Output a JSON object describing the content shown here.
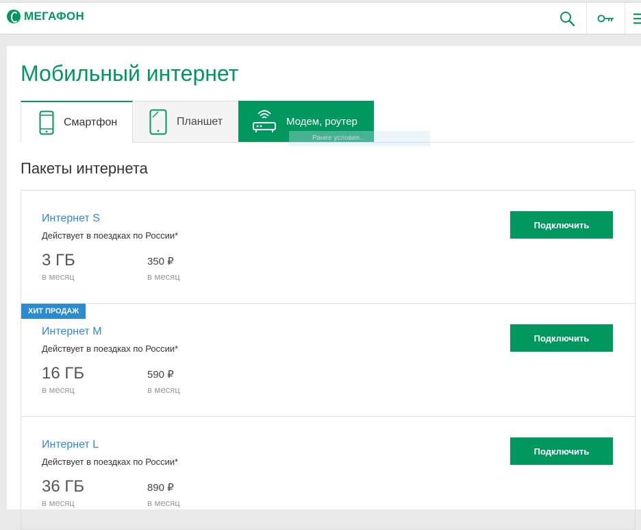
{
  "header": {
    "brand": "МЕГАФОН",
    "icons": {
      "search": "search-icon",
      "key": "key-icon",
      "menu": "menu-icon"
    },
    "accent_color": "#00985f"
  },
  "page": {
    "title": "Мобильный интернет"
  },
  "tabs": [
    {
      "label": "Смартфон",
      "icon": "smartphone-icon",
      "active": true
    },
    {
      "label": "Планшет",
      "icon": "tablet-icon",
      "active": false
    },
    {
      "label": "Модем, роутер",
      "icon": "router-icon",
      "highlighted": true
    }
  ],
  "tooltip": {
    "text": "Ранее условия..."
  },
  "section": {
    "title": "Пакеты интернета"
  },
  "packages": [
    {
      "name": "Интернет S",
      "description": "Действует в поездках по России*",
      "volume": "3 ГБ",
      "volume_period": "в месяц",
      "price": "350 ₽",
      "price_period": "в месяц",
      "button": "Подключить"
    },
    {
      "badge": "ХИТ ПРОДАЖ",
      "name": "Интернет M",
      "description": "Действует в поездках по России*",
      "volume": "16 ГБ",
      "volume_period": "в месяц",
      "price": "590 ₽",
      "price_period": "в месяц",
      "button": "Подключить"
    },
    {
      "name": "Интернет L",
      "description": "Действует в поездках по России*",
      "volume": "36 ГБ",
      "volume_period": "в месяц",
      "price": "890 ₽",
      "price_period": "в месяц",
      "button": "Подключить"
    }
  ]
}
